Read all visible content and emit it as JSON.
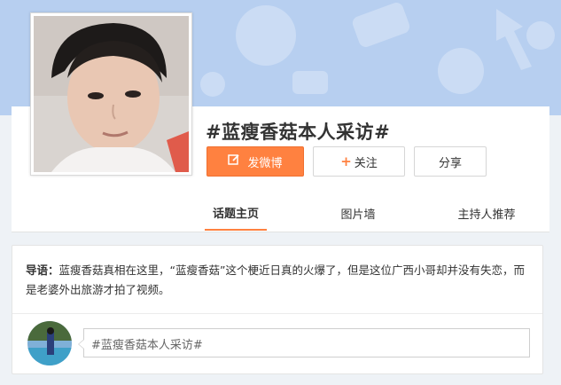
{
  "topic": {
    "title": "#蓝瘦香菇本人采访#"
  },
  "actions": {
    "post_label": "发微博",
    "follow_label": "关注",
    "share_label": "分享"
  },
  "tabs": [
    {
      "label": "话题主页",
      "active": true
    },
    {
      "label": "图片墙",
      "active": false
    },
    {
      "label": "主持人推荐",
      "active": false
    }
  ],
  "intro": {
    "lead": "导语：",
    "text": "蓝瘦香菇真相在这里，“蓝瘦香菇”这个梗近日真的火爆了，但是这位广西小哥却并没有失恋，而是老婆外出旅游才拍了视频。"
  },
  "composer": {
    "value": "#蓝瘦香菇本人采访#"
  },
  "colors": {
    "accent": "#ff8140",
    "banner": "#b7cff0"
  },
  "icons": {
    "post": "edit-icon",
    "follow": "plus-icon"
  }
}
